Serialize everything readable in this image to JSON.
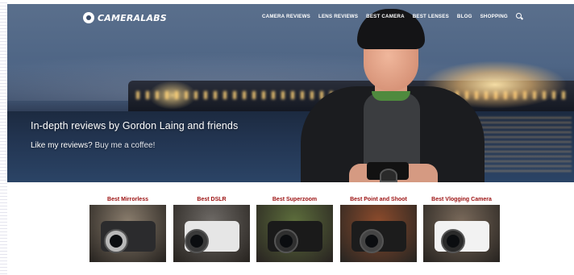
{
  "nav": {
    "logo_text": "CAMERALABS",
    "menu": [
      "CAMERA REVIEWS",
      "LENS REVIEWS",
      "BEST CAMERA",
      "BEST LENSES",
      "BLOG",
      "SHOPPING"
    ],
    "search_icon": "search-icon"
  },
  "hero": {
    "title": "In-depth reviews by Gordon Laing and friends",
    "subtitle_lead": "Like my reviews?",
    "subtitle_link": "Buy me a coffee!"
  },
  "categories": [
    {
      "label": "Best Mirrorless",
      "bg": "#8a7d6d",
      "body": "#2b2b2d",
      "lens": "#b8b8b8"
    },
    {
      "label": "Best DSLR",
      "bg": "#6e6a66",
      "body": "#e6e6e6",
      "lens": "#3a3a3a"
    },
    {
      "label": "Best Superzoom",
      "bg": "#5d6e3c",
      "body": "#1a1a1a",
      "lens": "#2f2f2f"
    },
    {
      "label": "Best Point and Shoot",
      "bg": "#8c4b2c",
      "body": "#1c1c1c",
      "lens": "#444444"
    },
    {
      "label": "Best Vlogging Camera",
      "bg": "#7a6a5b",
      "body": "#f2f2f2",
      "lens": "#2a2a2a"
    }
  ],
  "colors": {
    "category_label": "#9b1010",
    "nav_text": "#ffffff"
  }
}
